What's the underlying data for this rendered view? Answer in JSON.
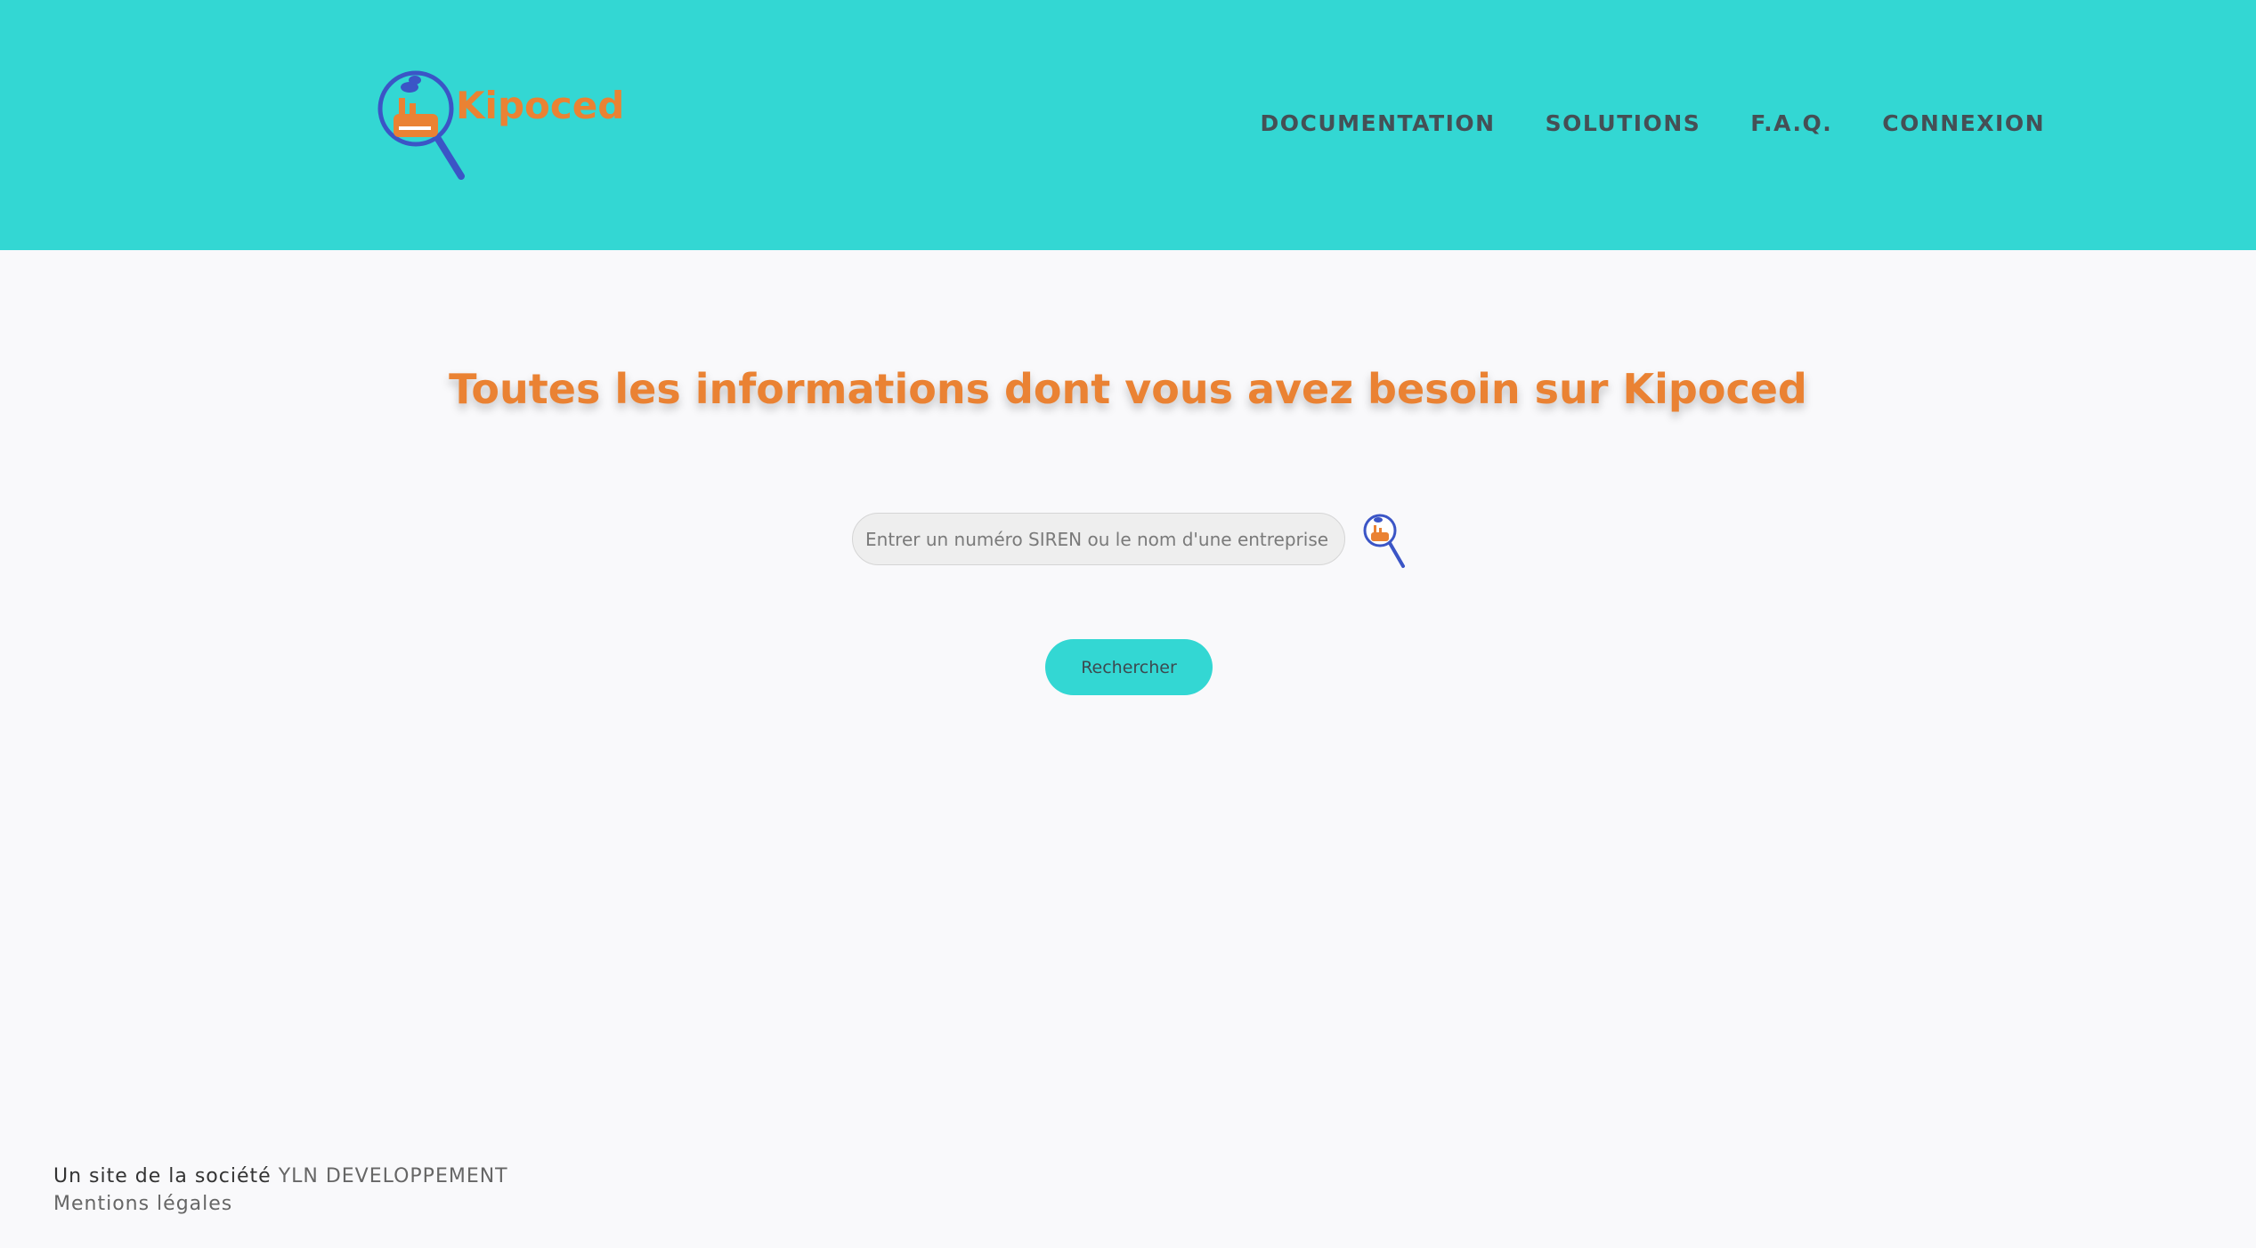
{
  "header": {
    "logo": {
      "text": "Kipoced",
      "icon": "magnifier-factory-logo-icon"
    },
    "nav": [
      {
        "label": "DOCUMENTATION"
      },
      {
        "label": "SOLUTIONS"
      },
      {
        "label": "F.A.Q."
      },
      {
        "label": "CONNEXION"
      }
    ]
  },
  "main": {
    "title": "Toutes les informations dont vous avez besoin sur Kipoced",
    "search": {
      "placeholder": "Entrer un numéro SIREN ou le nom d'une entreprise",
      "value": "",
      "icon": "search-logo-icon"
    },
    "button_label": "Rechercher"
  },
  "footer": {
    "prefix": "Un site de la société",
    "company": "YLN DEVELOPPEMENT",
    "legal": "Mentions légales"
  },
  "colors": {
    "header_bg": "#33d7d3",
    "accent_orange": "#ea8233",
    "nav_text": "#454f55",
    "page_bg": "#f9f9fb",
    "icon_blue": "#3b55c6"
  }
}
